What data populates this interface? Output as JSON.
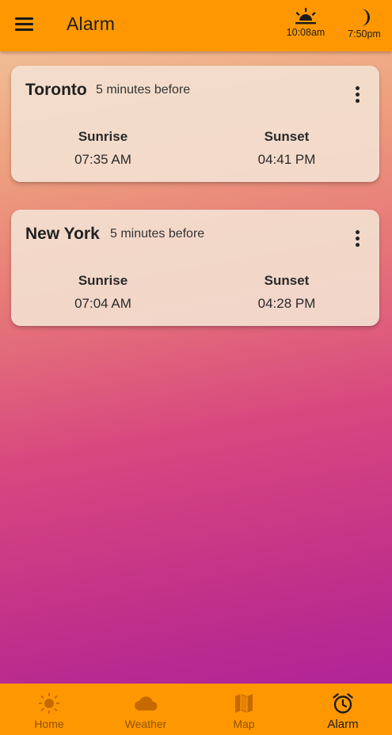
{
  "appbar": {
    "title": "Alarm",
    "sunrise_time": "10:08am",
    "sunset_time": "7:50pm",
    "icons": {
      "menu": "menu-icon",
      "sunrise": "sunrise-icon",
      "sunset": "moon-icon"
    }
  },
  "cards": [
    {
      "city": "Toronto",
      "note": "5 minutes before",
      "sunrise_label": "Sunrise",
      "sunrise_time": "07:35 AM",
      "sunset_label": "Sunset",
      "sunset_time": "04:41 PM"
    },
    {
      "city": "New York",
      "note": "5 minutes before",
      "sunrise_label": "Sunrise",
      "sunrise_time": "07:04 AM",
      "sunset_label": "Sunset",
      "sunset_time": "04:28 PM"
    }
  ],
  "bottom_nav": {
    "items": [
      {
        "label": "Home",
        "icon": "sun-icon"
      },
      {
        "label": "Weather",
        "icon": "cloud-icon"
      },
      {
        "label": "Map",
        "icon": "map-icon"
      },
      {
        "label": "Alarm",
        "icon": "alarm-clock-icon",
        "active": true
      }
    ]
  },
  "colors": {
    "appbar": "#ff9800",
    "card": "#f3e0d0",
    "gradient_top": "#f2c9a0",
    "gradient_bottom": "#a81f9e"
  }
}
